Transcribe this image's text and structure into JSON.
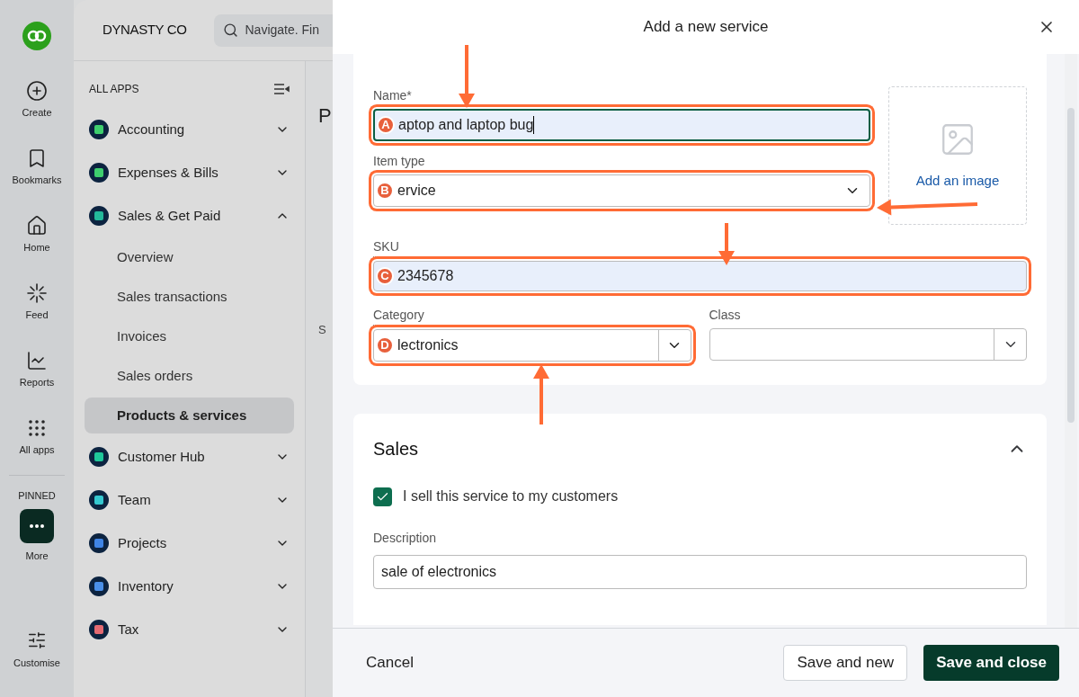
{
  "rail": {
    "items": [
      {
        "kind": "create",
        "label": "Create"
      },
      {
        "kind": "bookmark",
        "label": "Bookmarks"
      },
      {
        "kind": "home",
        "label": "Home"
      },
      {
        "kind": "feed",
        "label": "Feed"
      },
      {
        "kind": "reports",
        "label": "Reports"
      },
      {
        "kind": "apps",
        "label": "All apps"
      }
    ],
    "pinned_heading": "PINNED",
    "pinned": [
      {
        "kind": "more",
        "label": "More"
      }
    ],
    "customise": "Customise"
  },
  "header": {
    "company": "DYNASTY CO",
    "search": {
      "placeholder": "Navigate. Fin"
    }
  },
  "nav": {
    "heading": "ALL APPS",
    "apps": [
      {
        "label": "Accounting",
        "color": "#3ecf6e",
        "expanded": false
      },
      {
        "label": "Expenses & Bills",
        "color": "#3ecf6e",
        "expanded": false
      },
      {
        "label": "Sales & Get Paid",
        "color": "#23b89a",
        "expanded": true,
        "children": [
          {
            "label": "Overview",
            "selected": false
          },
          {
            "label": "Sales transactions",
            "selected": false
          },
          {
            "label": "Invoices",
            "selected": false
          },
          {
            "label": "Sales orders",
            "selected": false
          },
          {
            "label": "Products & services",
            "selected": true
          }
        ]
      },
      {
        "label": "Customer Hub",
        "color": "#1fc79a",
        "expanded": false
      },
      {
        "label": "Team",
        "color": "#35c8d0",
        "expanded": false
      },
      {
        "label": "Projects",
        "color": "#3f84e5",
        "expanded": false
      },
      {
        "label": "Inventory",
        "color": "#4a8fe8",
        "expanded": false
      },
      {
        "label": "Tax",
        "color": "#e36a72",
        "expanded": false
      }
    ]
  },
  "background_page": {
    "title_fragment": "P",
    "label_fragment": "S"
  },
  "dialog": {
    "title": "Add a new service",
    "name": {
      "label": "Name*",
      "value": "aptop and laptop bug",
      "marker": "A",
      "highlighted": true,
      "focused": true
    },
    "item_type": {
      "label": "Item type",
      "value": "ervice",
      "marker": "B",
      "highlighted": true
    },
    "image": {
      "label": "Add an image"
    },
    "sku": {
      "label": "SKU",
      "value": "2345678",
      "marker": "C",
      "highlighted": true
    },
    "category": {
      "label": "Category",
      "value": "lectronics",
      "marker": "D",
      "highlighted": true
    },
    "class": {
      "label": "Class",
      "highlighted": false
    },
    "sales": {
      "heading": "Sales",
      "expanded": true,
      "checkbox": {
        "label": "I sell this service to my customers",
        "checked": true
      },
      "description": {
        "label": "Description",
        "value": "sale of electronics"
      }
    },
    "footer": {
      "cancel": "Cancel",
      "save_new": "Save and new",
      "save_close": "Save and close"
    }
  }
}
